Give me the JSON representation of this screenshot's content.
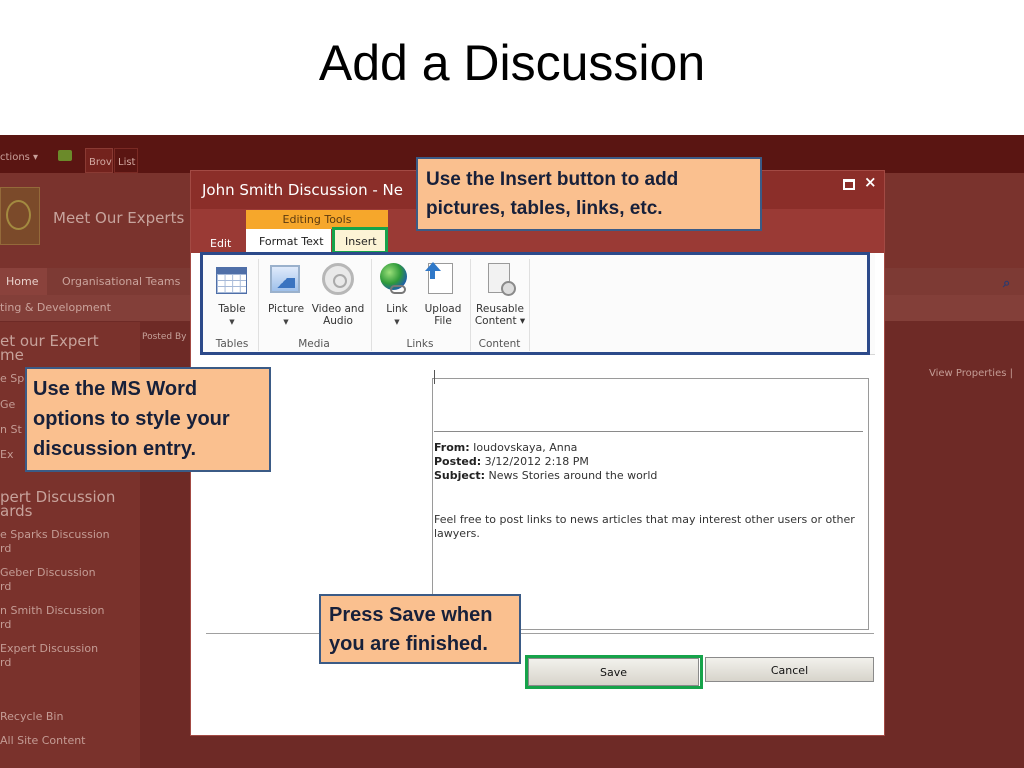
{
  "slide": {
    "title": "Add a Discussion"
  },
  "background": {
    "actions_label": "ctions ▾",
    "tab_browse": "Brov",
    "tab_list": "List",
    "site_name": "Meet Our Experts",
    "nav_home": "Home",
    "nav_teams": "Organisational Teams",
    "breadcrumb": "ting & Development",
    "left_items": [
      {
        "text": "et our Expert",
        "kind": "h"
      },
      {
        "text": "me",
        "kind": "h"
      },
      {
        "text": "e Sp",
        "kind": "l"
      },
      {
        "text": "Ge",
        "kind": "l"
      },
      {
        "text": "n St",
        "kind": "l"
      },
      {
        "text": "Ex",
        "kind": "l"
      },
      {
        "text": "pert Discussion",
        "kind": "h"
      },
      {
        "text": "ards",
        "kind": "h"
      },
      {
        "text": "e Sparks Discussion",
        "kind": "l"
      },
      {
        "text": "rd",
        "kind": "l"
      },
      {
        "text": "Geber Discussion",
        "kind": "l"
      },
      {
        "text": "rd",
        "kind": "l"
      },
      {
        "text": "n Smith Discussion",
        "kind": "l"
      },
      {
        "text": "rd",
        "kind": "l"
      },
      {
        "text": "Expert Discussion",
        "kind": "l"
      },
      {
        "text": "rd",
        "kind": "l"
      },
      {
        "text": "Recycle Bin",
        "kind": "l"
      },
      {
        "text": "All Site Content",
        "kind": "l"
      }
    ],
    "posted_by": "Posted By",
    "view_properties": "View Properties |"
  },
  "dialog": {
    "title": "John Smith Discussion - Ne",
    "context_group": "Editing Tools",
    "tabs": {
      "edit": "Edit",
      "format_text": "Format Text",
      "insert": "Insert"
    },
    "ribbon": {
      "buttons": {
        "table": "Table",
        "picture": "Picture",
        "video_line1": "Video and",
        "video_line2": "Audio",
        "link": "Link",
        "upload_line1": "Upload",
        "upload_line2": "File",
        "reusable_line1": "Reusable",
        "reusable_line2": "Content ▾"
      },
      "groups": {
        "tables": "Tables",
        "media": "Media",
        "links": "Links",
        "content": "Content"
      }
    },
    "message": {
      "from_label": "From:",
      "from_value": " Ioudovskaya, Anna",
      "posted_label": "Posted:",
      "posted_value": " 3/12/2012 2:18 PM",
      "subject_label": "Subject:",
      "subject_value": " News Stories around the world",
      "body": "Feel free to post links to news articles that may interest other users or other lawyers."
    },
    "buttons": {
      "save": "Save",
      "cancel": "Cancel"
    }
  },
  "callouts": {
    "insert_line1": "Use the Insert button to add",
    "insert_line2": "pictures, tables, links, etc.",
    "word_line1": "Use the MS Word",
    "word_line2": "options to style your",
    "word_line3": "discussion entry.",
    "save_line1": "Press Save when",
    "save_line2": "you are finished."
  },
  "colors": {
    "titlebar": "#8b2e29",
    "context_tab": "#f6a72b",
    "highlight_green": "#16a34a",
    "highlight_blue": "#2c4a8a",
    "callout_fill": "#fac08f"
  }
}
